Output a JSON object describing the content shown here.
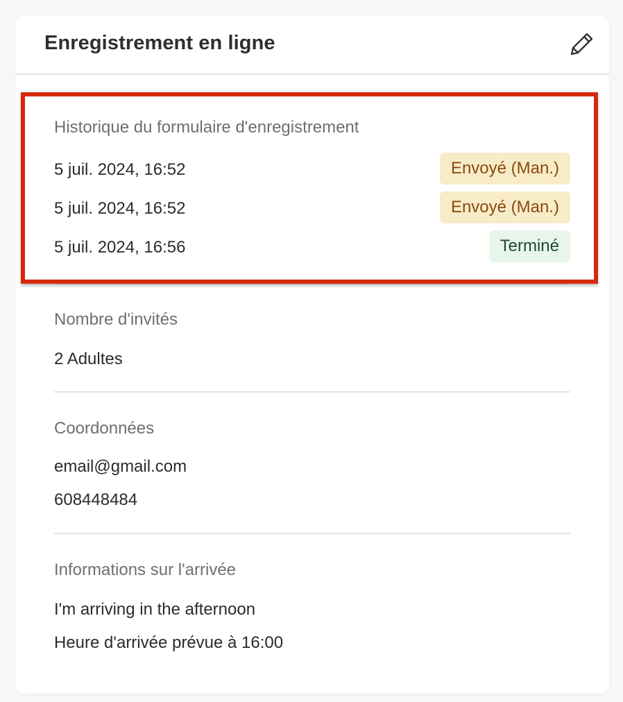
{
  "card": {
    "title": "Enregistrement en ligne",
    "edit_icon": "pencil-icon"
  },
  "history": {
    "label": "Historique du formulaire d'enregistrement",
    "entries": [
      {
        "datetime": "5 juil. 2024, 16:52",
        "status": "Envoyé (Man.)",
        "status_type": "sent"
      },
      {
        "datetime": "5 juil. 2024, 16:52",
        "status": "Envoyé (Man.)",
        "status_type": "sent"
      },
      {
        "datetime": "5 juil. 2024, 16:56",
        "status": "Terminé",
        "status_type": "done"
      }
    ]
  },
  "guests": {
    "label": "Nombre d'invités",
    "value": "2 Adultes"
  },
  "contact": {
    "label": "Coordonnées",
    "email": "email@gmail.com",
    "phone": "608448484"
  },
  "arrival": {
    "label": "Informations sur l'arrivée",
    "note": "I'm arriving in the afternoon",
    "expected_time": "Heure d'arrivée prévue à 16:00"
  },
  "colors": {
    "highlight": "#d7280f",
    "badge_sent_bg": "#f8ecc8",
    "badge_sent_text": "#8a4a10",
    "badge_done_bg": "#e8f5ea",
    "badge_done_text": "#1e4a30"
  }
}
